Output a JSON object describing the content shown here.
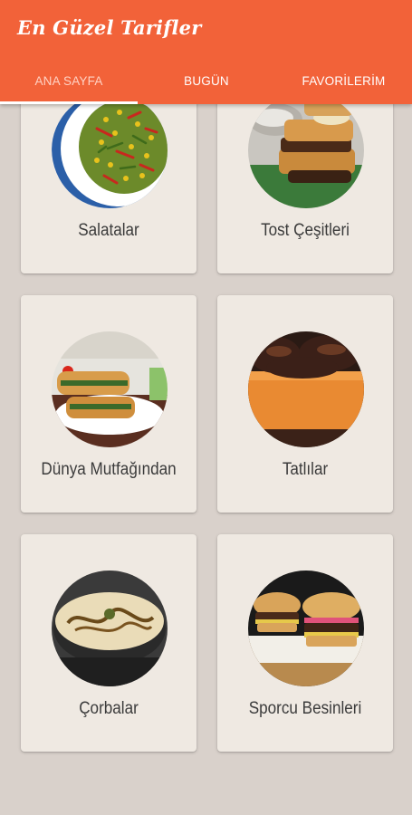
{
  "app": {
    "title": "En Güzel Tarifler"
  },
  "tabs": [
    {
      "label": "ANA SAYFA"
    },
    {
      "label": "BUGÜN"
    },
    {
      "label": "FAVORİLERİM"
    }
  ],
  "categories": [
    {
      "label": "Salatalar",
      "image": "salad-photo"
    },
    {
      "label": "Tost Çeşitleri",
      "image": "toast-photo"
    },
    {
      "label": "Dünya Mutfağından",
      "image": "borek-photo"
    },
    {
      "label": "Tatlılar",
      "image": "dessert-photo"
    },
    {
      "label": "Çorbalar",
      "image": "soup-photo"
    },
    {
      "label": "Sporcu Besinleri",
      "image": "burger-photo"
    }
  ],
  "colors": {
    "appbar": "#f26239",
    "background": "#d9d1cb",
    "card": "#efe9e2"
  }
}
